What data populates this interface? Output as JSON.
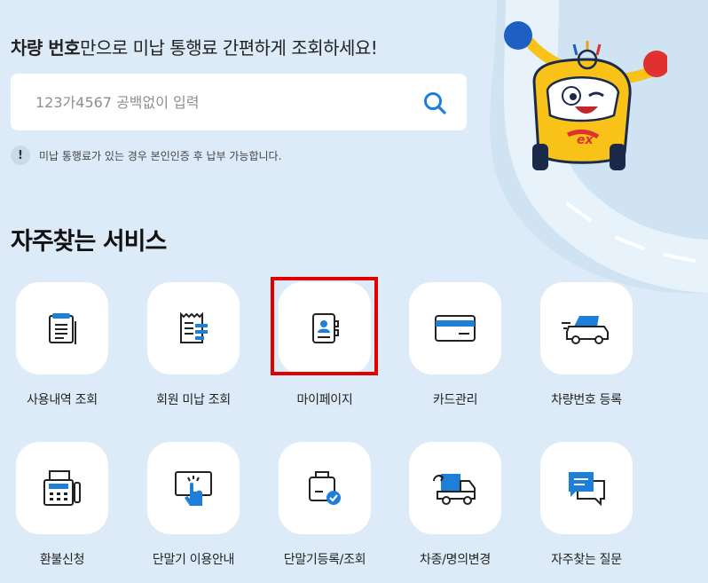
{
  "header": {
    "title_bold": "차량 번호",
    "title_rest": "만으로 미납 통행료 간편하게 조회하세요!"
  },
  "search": {
    "placeholder": "123가4567 공백없이 입력",
    "value": ""
  },
  "notice": {
    "icon_text": "!",
    "text": "미납 통행료가 있는 경우 본인인증 후 납부 가능합니다."
  },
  "section": {
    "title": "자주찾는 서비스"
  },
  "services": [
    {
      "label": "사용내역 조회",
      "icon": "clipboard-list-icon"
    },
    {
      "label": "회원 미납 조회",
      "icon": "receipt-icon"
    },
    {
      "label": "마이페이지",
      "icon": "profile-book-icon"
    },
    {
      "label": "카드관리",
      "icon": "credit-card-icon"
    },
    {
      "label": "차량번호 등록",
      "icon": "car-register-icon"
    },
    {
      "label": "환불신청",
      "icon": "fax-refund-icon"
    },
    {
      "label": "단말기 이용안내",
      "icon": "touch-terminal-icon"
    },
    {
      "label": "단말기등록/조회",
      "icon": "device-check-icon"
    },
    {
      "label": "차종/명의변경",
      "icon": "truck-change-icon"
    },
    {
      "label": "자주찾는 질문",
      "icon": "chat-faq-icon"
    }
  ],
  "colors": {
    "background": "#dcebf7",
    "accent_blue": "#1e7fd8",
    "highlight_red": "#e10000",
    "mascot_yellow": "#f8c219"
  },
  "mascot": {
    "badge_text": "ex"
  }
}
